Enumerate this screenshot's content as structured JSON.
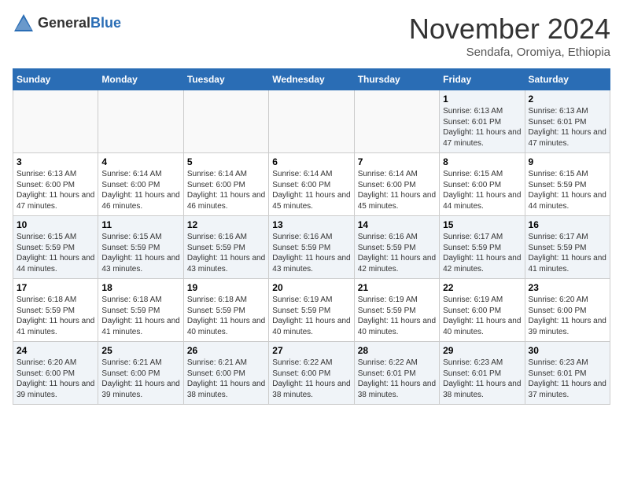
{
  "header": {
    "logo_general": "General",
    "logo_blue": "Blue",
    "month_title": "November 2024",
    "subtitle": "Sendafa, Oromiya, Ethiopia"
  },
  "days_of_week": [
    "Sunday",
    "Monday",
    "Tuesday",
    "Wednesday",
    "Thursday",
    "Friday",
    "Saturday"
  ],
  "weeks": [
    [
      {
        "day": "",
        "info": ""
      },
      {
        "day": "",
        "info": ""
      },
      {
        "day": "",
        "info": ""
      },
      {
        "day": "",
        "info": ""
      },
      {
        "day": "",
        "info": ""
      },
      {
        "day": "1",
        "info": "Sunrise: 6:13 AM\nSunset: 6:01 PM\nDaylight: 11 hours and 47 minutes."
      },
      {
        "day": "2",
        "info": "Sunrise: 6:13 AM\nSunset: 6:01 PM\nDaylight: 11 hours and 47 minutes."
      }
    ],
    [
      {
        "day": "3",
        "info": "Sunrise: 6:13 AM\nSunset: 6:00 PM\nDaylight: 11 hours and 47 minutes."
      },
      {
        "day": "4",
        "info": "Sunrise: 6:14 AM\nSunset: 6:00 PM\nDaylight: 11 hours and 46 minutes."
      },
      {
        "day": "5",
        "info": "Sunrise: 6:14 AM\nSunset: 6:00 PM\nDaylight: 11 hours and 46 minutes."
      },
      {
        "day": "6",
        "info": "Sunrise: 6:14 AM\nSunset: 6:00 PM\nDaylight: 11 hours and 45 minutes."
      },
      {
        "day": "7",
        "info": "Sunrise: 6:14 AM\nSunset: 6:00 PM\nDaylight: 11 hours and 45 minutes."
      },
      {
        "day": "8",
        "info": "Sunrise: 6:15 AM\nSunset: 6:00 PM\nDaylight: 11 hours and 44 minutes."
      },
      {
        "day": "9",
        "info": "Sunrise: 6:15 AM\nSunset: 5:59 PM\nDaylight: 11 hours and 44 minutes."
      }
    ],
    [
      {
        "day": "10",
        "info": "Sunrise: 6:15 AM\nSunset: 5:59 PM\nDaylight: 11 hours and 44 minutes."
      },
      {
        "day": "11",
        "info": "Sunrise: 6:15 AM\nSunset: 5:59 PM\nDaylight: 11 hours and 43 minutes."
      },
      {
        "day": "12",
        "info": "Sunrise: 6:16 AM\nSunset: 5:59 PM\nDaylight: 11 hours and 43 minutes."
      },
      {
        "day": "13",
        "info": "Sunrise: 6:16 AM\nSunset: 5:59 PM\nDaylight: 11 hours and 43 minutes."
      },
      {
        "day": "14",
        "info": "Sunrise: 6:16 AM\nSunset: 5:59 PM\nDaylight: 11 hours and 42 minutes."
      },
      {
        "day": "15",
        "info": "Sunrise: 6:17 AM\nSunset: 5:59 PM\nDaylight: 11 hours and 42 minutes."
      },
      {
        "day": "16",
        "info": "Sunrise: 6:17 AM\nSunset: 5:59 PM\nDaylight: 11 hours and 41 minutes."
      }
    ],
    [
      {
        "day": "17",
        "info": "Sunrise: 6:18 AM\nSunset: 5:59 PM\nDaylight: 11 hours and 41 minutes."
      },
      {
        "day": "18",
        "info": "Sunrise: 6:18 AM\nSunset: 5:59 PM\nDaylight: 11 hours and 41 minutes."
      },
      {
        "day": "19",
        "info": "Sunrise: 6:18 AM\nSunset: 5:59 PM\nDaylight: 11 hours and 40 minutes."
      },
      {
        "day": "20",
        "info": "Sunrise: 6:19 AM\nSunset: 5:59 PM\nDaylight: 11 hours and 40 minutes."
      },
      {
        "day": "21",
        "info": "Sunrise: 6:19 AM\nSunset: 5:59 PM\nDaylight: 11 hours and 40 minutes."
      },
      {
        "day": "22",
        "info": "Sunrise: 6:19 AM\nSunset: 6:00 PM\nDaylight: 11 hours and 40 minutes."
      },
      {
        "day": "23",
        "info": "Sunrise: 6:20 AM\nSunset: 6:00 PM\nDaylight: 11 hours and 39 minutes."
      }
    ],
    [
      {
        "day": "24",
        "info": "Sunrise: 6:20 AM\nSunset: 6:00 PM\nDaylight: 11 hours and 39 minutes."
      },
      {
        "day": "25",
        "info": "Sunrise: 6:21 AM\nSunset: 6:00 PM\nDaylight: 11 hours and 39 minutes."
      },
      {
        "day": "26",
        "info": "Sunrise: 6:21 AM\nSunset: 6:00 PM\nDaylight: 11 hours and 38 minutes."
      },
      {
        "day": "27",
        "info": "Sunrise: 6:22 AM\nSunset: 6:00 PM\nDaylight: 11 hours and 38 minutes."
      },
      {
        "day": "28",
        "info": "Sunrise: 6:22 AM\nSunset: 6:01 PM\nDaylight: 11 hours and 38 minutes."
      },
      {
        "day": "29",
        "info": "Sunrise: 6:23 AM\nSunset: 6:01 PM\nDaylight: 11 hours and 38 minutes."
      },
      {
        "day": "30",
        "info": "Sunrise: 6:23 AM\nSunset: 6:01 PM\nDaylight: 11 hours and 37 minutes."
      }
    ]
  ]
}
